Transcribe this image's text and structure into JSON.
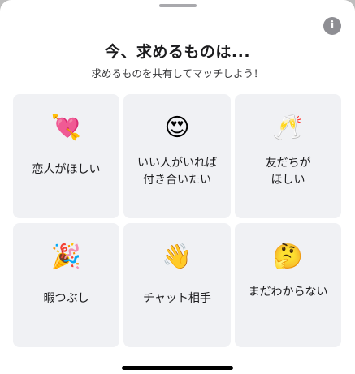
{
  "sheet": {
    "title": "今、求めるものは...",
    "subtitle": "求めるものを共有してマッチしよう！",
    "info_icon": "info-icon",
    "info_glyph": "i"
  },
  "options": [
    {
      "emoji": "💘",
      "icon": "heart-with-arrow-icon",
      "label": "恋人がほしい"
    },
    {
      "emoji": "😍",
      "icon": "heart-eyes-face-icon",
      "label": "いい人がいれば\n付き合いたい"
    },
    {
      "emoji": "🥂",
      "icon": "clinking-glasses-icon",
      "label": "友だちが\nほしい"
    },
    {
      "emoji": "🎉",
      "icon": "party-popper-icon",
      "label": "暇つぶし"
    },
    {
      "emoji": "👋",
      "icon": "waving-hand-icon",
      "label": "チャット相手"
    },
    {
      "emoji": "🤔",
      "icon": "thinking-face-icon",
      "label": "まだわからない"
    }
  ]
}
